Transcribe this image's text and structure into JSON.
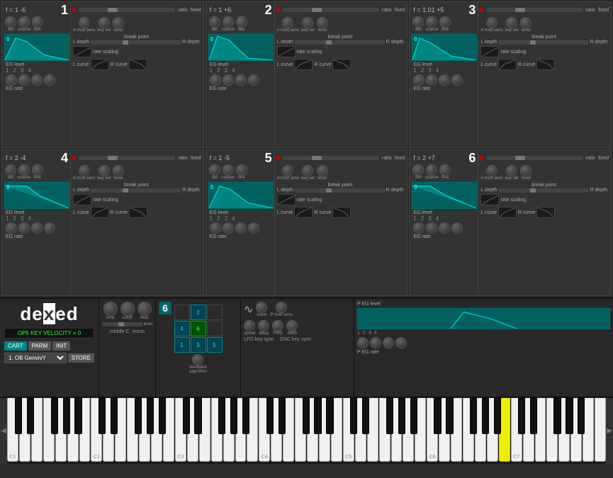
{
  "operators": [
    {
      "id": 1,
      "formula": "f = 1 -6",
      "ratio": "ratio",
      "fixed": "fixed",
      "number": "1",
      "knobs": [
        "det",
        "coarse",
        "fine"
      ],
      "right_knobs": [
        "A mod sens",
        "key vel",
        "level"
      ],
      "eg_level_label": "EG level",
      "eg_rate_label": "EG rate",
      "seg_nums": [
        "1",
        "2",
        "3",
        "4"
      ],
      "break_point": "break point",
      "l_depth": "L depth",
      "r_depth": "R depth",
      "rate_scaling": "rate scaling",
      "l_curve": "L curve",
      "r_curve": "R curve"
    },
    {
      "id": 2,
      "formula": "f = 1 +6",
      "ratio": "ratio",
      "fixed": "fixed",
      "number": "2",
      "knobs": [
        "det",
        "coarse",
        "fine"
      ],
      "right_knobs": [
        "A mod sens",
        "key vel",
        "level"
      ],
      "eg_level_label": "EG level",
      "eg_rate_label": "EG rate",
      "seg_nums": [
        "1",
        "2",
        "3",
        "4"
      ],
      "break_point": "break point",
      "l_depth": "L depth",
      "r_depth": "R depth",
      "rate_scaling": "rate scaling",
      "l_curve": "L curve",
      "r_curve": "R curve"
    },
    {
      "id": 3,
      "formula": "f = 1.01 +5",
      "ratio": "ratio",
      "fixed": "fixed",
      "number": "3",
      "knobs": [
        "det",
        "coarse",
        "fine"
      ],
      "right_knobs": [
        "A mod sens",
        "key vel",
        "level"
      ],
      "eg_level_label": "EG level",
      "eg_rate_label": "EG rate",
      "seg_nums": [
        "1",
        "2",
        "3",
        "4"
      ],
      "break_point": "break point",
      "l_depth": "L depth",
      "r_depth": "R depth",
      "rate_scaling": "rate scaling",
      "l_curve": "L curve",
      "r_curve": "R curve"
    },
    {
      "id": 4,
      "formula": "f = 2 -4",
      "ratio": "ratio",
      "fixed": "fixed",
      "number": "4",
      "knobs": [
        "det",
        "coarse",
        "fine"
      ],
      "right_knobs": [
        "A mod sens",
        "key vel",
        "level"
      ],
      "eg_level_label": "EG level",
      "eg_rate_label": "EG rate",
      "seg_nums": [
        "1",
        "2",
        "3",
        "4"
      ],
      "break_point": "break point",
      "l_depth": "L depth",
      "r_depth": "R depth",
      "rate_scaling": "rate scaling",
      "l_curve": "L curve",
      "r_curve": "R curve"
    },
    {
      "id": 5,
      "formula": "f = 1 -5",
      "ratio": "ratio",
      "fixed": "fixed",
      "number": "5",
      "knobs": [
        "det",
        "coarse",
        "fine"
      ],
      "right_knobs": [
        "A mod sens",
        "key vel",
        "level"
      ],
      "eg_level_label": "EG level",
      "eg_rate_label": "EG rate",
      "seg_nums": [
        "1",
        "2",
        "3",
        "4"
      ],
      "break_point": "break point",
      "l_depth": "L depth",
      "r_depth": "R depth",
      "rate_scaling": "rate scaling",
      "l_curve": "L curve",
      "r_curve": "R curve"
    },
    {
      "id": 6,
      "formula": "f = 2 +7",
      "ratio": "ratio",
      "fixed": "fixed",
      "number": "6",
      "knobs": [
        "det",
        "coarse",
        "fine"
      ],
      "right_knobs": [
        "A mod sens",
        "key vel",
        "level"
      ],
      "eg_level_label": "EG level",
      "eg_rate_label": "EG rate",
      "seg_nums": [
        "1",
        "2",
        "3",
        "4"
      ],
      "break_point": "break point",
      "l_depth": "L depth",
      "r_depth": "R depth",
      "rate_scaling": "rate scaling",
      "l_curve": "L curve",
      "r_curve": "R curve"
    }
  ],
  "bottom": {
    "logo": "dexed",
    "status": "OP5 KEY VELOCITY = 0",
    "buttons": {
      "cart": "CART",
      "parm": "PARM",
      "init": "INIT",
      "store": "STORE"
    },
    "preset": "1. OB GenvivY",
    "tune_label": "tune",
    "cutoff_label": "cutoff",
    "reso_label": "reso",
    "level_label": "level",
    "middle_c_label": "middle C",
    "mono_label": "mono",
    "algorithm_label": "algorithm",
    "algorithm_number": "6",
    "feedback_label": "feedback",
    "wave_label": "wave",
    "p_mod_sens_label": "P mod sens",
    "speed_label": "speed",
    "delay_label": "delay",
    "pmd_label": "PMD",
    "amd_label": "AMD",
    "lfo_key_sync_label": "LFO key sync",
    "osc_key_sync_label": "OSC key sync",
    "p_eg_level_label": "P EG level",
    "p_eg_rate_label": "P EG rate"
  },
  "keyboard": {
    "octaves": [
      "C1",
      "C2",
      "C3",
      "C4",
      "C5",
      "C6",
      "C7"
    ]
  },
  "colors": {
    "accent": "#008888",
    "bg": "#2a2a2a",
    "op_bg": "#333333",
    "eg_bg": "#005f5f",
    "red_dot": "#cc0000"
  }
}
